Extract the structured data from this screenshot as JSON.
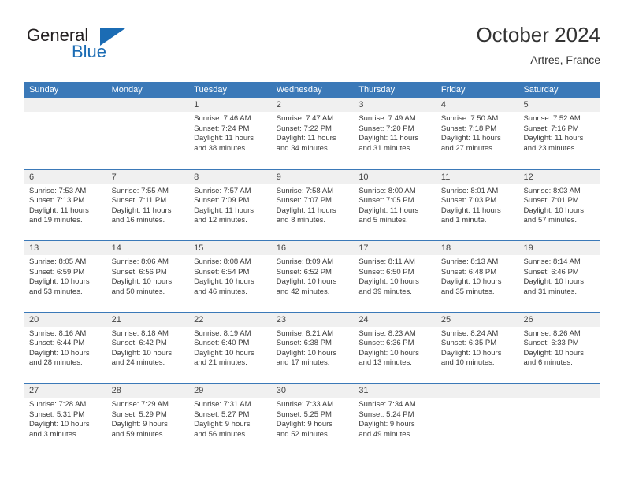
{
  "brand": {
    "name_top": "General",
    "name_bottom": "Blue",
    "triangle_color": "#1b6cb4"
  },
  "header": {
    "title": "October 2024",
    "subtitle": "Artres, France"
  },
  "colors": {
    "header_blue": "#3b79b8",
    "daynum_background": "#f0f0f0",
    "text": "#3a3a3a"
  },
  "weekdays": [
    "Sunday",
    "Monday",
    "Tuesday",
    "Wednesday",
    "Thursday",
    "Friday",
    "Saturday"
  ],
  "labels": {
    "sunrise_prefix": "Sunrise:",
    "sunset_prefix": "Sunset:",
    "daylight_prefix": "Daylight:"
  },
  "weeks": [
    [
      {
        "date": "",
        "empty": true
      },
      {
        "date": "",
        "empty": true
      },
      {
        "date": "1",
        "sunrise": "Sunrise: 7:46 AM",
        "sunset": "Sunset: 7:24 PM",
        "daylight_line1": "Daylight: 11 hours",
        "daylight_line2": "and 38 minutes."
      },
      {
        "date": "2",
        "sunrise": "Sunrise: 7:47 AM",
        "sunset": "Sunset: 7:22 PM",
        "daylight_line1": "Daylight: 11 hours",
        "daylight_line2": "and 34 minutes."
      },
      {
        "date": "3",
        "sunrise": "Sunrise: 7:49 AM",
        "sunset": "Sunset: 7:20 PM",
        "daylight_line1": "Daylight: 11 hours",
        "daylight_line2": "and 31 minutes."
      },
      {
        "date": "4",
        "sunrise": "Sunrise: 7:50 AM",
        "sunset": "Sunset: 7:18 PM",
        "daylight_line1": "Daylight: 11 hours",
        "daylight_line2": "and 27 minutes."
      },
      {
        "date": "5",
        "sunrise": "Sunrise: 7:52 AM",
        "sunset": "Sunset: 7:16 PM",
        "daylight_line1": "Daylight: 11 hours",
        "daylight_line2": "and 23 minutes."
      }
    ],
    [
      {
        "date": "6",
        "sunrise": "Sunrise: 7:53 AM",
        "sunset": "Sunset: 7:13 PM",
        "daylight_line1": "Daylight: 11 hours",
        "daylight_line2": "and 19 minutes."
      },
      {
        "date": "7",
        "sunrise": "Sunrise: 7:55 AM",
        "sunset": "Sunset: 7:11 PM",
        "daylight_line1": "Daylight: 11 hours",
        "daylight_line2": "and 16 minutes."
      },
      {
        "date": "8",
        "sunrise": "Sunrise: 7:57 AM",
        "sunset": "Sunset: 7:09 PM",
        "daylight_line1": "Daylight: 11 hours",
        "daylight_line2": "and 12 minutes."
      },
      {
        "date": "9",
        "sunrise": "Sunrise: 7:58 AM",
        "sunset": "Sunset: 7:07 PM",
        "daylight_line1": "Daylight: 11 hours",
        "daylight_line2": "and 8 minutes."
      },
      {
        "date": "10",
        "sunrise": "Sunrise: 8:00 AM",
        "sunset": "Sunset: 7:05 PM",
        "daylight_line1": "Daylight: 11 hours",
        "daylight_line2": "and 5 minutes."
      },
      {
        "date": "11",
        "sunrise": "Sunrise: 8:01 AM",
        "sunset": "Sunset: 7:03 PM",
        "daylight_line1": "Daylight: 11 hours",
        "daylight_line2": "and 1 minute."
      },
      {
        "date": "12",
        "sunrise": "Sunrise: 8:03 AM",
        "sunset": "Sunset: 7:01 PM",
        "daylight_line1": "Daylight: 10 hours",
        "daylight_line2": "and 57 minutes."
      }
    ],
    [
      {
        "date": "13",
        "sunrise": "Sunrise: 8:05 AM",
        "sunset": "Sunset: 6:59 PM",
        "daylight_line1": "Daylight: 10 hours",
        "daylight_line2": "and 53 minutes."
      },
      {
        "date": "14",
        "sunrise": "Sunrise: 8:06 AM",
        "sunset": "Sunset: 6:56 PM",
        "daylight_line1": "Daylight: 10 hours",
        "daylight_line2": "and 50 minutes."
      },
      {
        "date": "15",
        "sunrise": "Sunrise: 8:08 AM",
        "sunset": "Sunset: 6:54 PM",
        "daylight_line1": "Daylight: 10 hours",
        "daylight_line2": "and 46 minutes."
      },
      {
        "date": "16",
        "sunrise": "Sunrise: 8:09 AM",
        "sunset": "Sunset: 6:52 PM",
        "daylight_line1": "Daylight: 10 hours",
        "daylight_line2": "and 42 minutes."
      },
      {
        "date": "17",
        "sunrise": "Sunrise: 8:11 AM",
        "sunset": "Sunset: 6:50 PM",
        "daylight_line1": "Daylight: 10 hours",
        "daylight_line2": "and 39 minutes."
      },
      {
        "date": "18",
        "sunrise": "Sunrise: 8:13 AM",
        "sunset": "Sunset: 6:48 PM",
        "daylight_line1": "Daylight: 10 hours",
        "daylight_line2": "and 35 minutes."
      },
      {
        "date": "19",
        "sunrise": "Sunrise: 8:14 AM",
        "sunset": "Sunset: 6:46 PM",
        "daylight_line1": "Daylight: 10 hours",
        "daylight_line2": "and 31 minutes."
      }
    ],
    [
      {
        "date": "20",
        "sunrise": "Sunrise: 8:16 AM",
        "sunset": "Sunset: 6:44 PM",
        "daylight_line1": "Daylight: 10 hours",
        "daylight_line2": "and 28 minutes."
      },
      {
        "date": "21",
        "sunrise": "Sunrise: 8:18 AM",
        "sunset": "Sunset: 6:42 PM",
        "daylight_line1": "Daylight: 10 hours",
        "daylight_line2": "and 24 minutes."
      },
      {
        "date": "22",
        "sunrise": "Sunrise: 8:19 AM",
        "sunset": "Sunset: 6:40 PM",
        "daylight_line1": "Daylight: 10 hours",
        "daylight_line2": "and 21 minutes."
      },
      {
        "date": "23",
        "sunrise": "Sunrise: 8:21 AM",
        "sunset": "Sunset: 6:38 PM",
        "daylight_line1": "Daylight: 10 hours",
        "daylight_line2": "and 17 minutes."
      },
      {
        "date": "24",
        "sunrise": "Sunrise: 8:23 AM",
        "sunset": "Sunset: 6:36 PM",
        "daylight_line1": "Daylight: 10 hours",
        "daylight_line2": "and 13 minutes."
      },
      {
        "date": "25",
        "sunrise": "Sunrise: 8:24 AM",
        "sunset": "Sunset: 6:35 PM",
        "daylight_line1": "Daylight: 10 hours",
        "daylight_line2": "and 10 minutes."
      },
      {
        "date": "26",
        "sunrise": "Sunrise: 8:26 AM",
        "sunset": "Sunset: 6:33 PM",
        "daylight_line1": "Daylight: 10 hours",
        "daylight_line2": "and 6 minutes."
      }
    ],
    [
      {
        "date": "27",
        "sunrise": "Sunrise: 7:28 AM",
        "sunset": "Sunset: 5:31 PM",
        "daylight_line1": "Daylight: 10 hours",
        "daylight_line2": "and 3 minutes."
      },
      {
        "date": "28",
        "sunrise": "Sunrise: 7:29 AM",
        "sunset": "Sunset: 5:29 PM",
        "daylight_line1": "Daylight: 9 hours",
        "daylight_line2": "and 59 minutes."
      },
      {
        "date": "29",
        "sunrise": "Sunrise: 7:31 AM",
        "sunset": "Sunset: 5:27 PM",
        "daylight_line1": "Daylight: 9 hours",
        "daylight_line2": "and 56 minutes."
      },
      {
        "date": "30",
        "sunrise": "Sunrise: 7:33 AM",
        "sunset": "Sunset: 5:25 PM",
        "daylight_line1": "Daylight: 9 hours",
        "daylight_line2": "and 52 minutes."
      },
      {
        "date": "31",
        "sunrise": "Sunrise: 7:34 AM",
        "sunset": "Sunset: 5:24 PM",
        "daylight_line1": "Daylight: 9 hours",
        "daylight_line2": "and 49 minutes."
      },
      {
        "date": "",
        "empty": true
      },
      {
        "date": "",
        "empty": true
      }
    ]
  ]
}
